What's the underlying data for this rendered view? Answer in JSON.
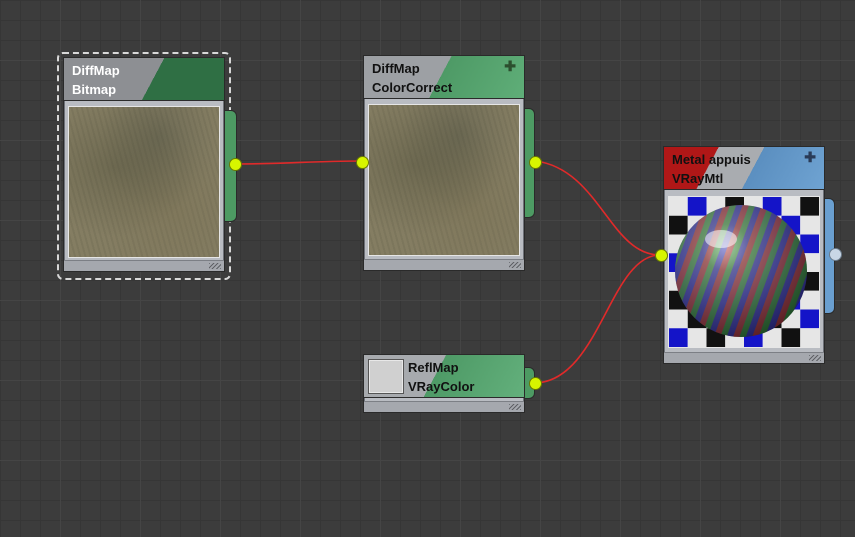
{
  "nodes": {
    "bitmap": {
      "name": "DiffMap",
      "type": "Bitmap"
    },
    "colorcorrect": {
      "name": "DiffMap",
      "type": "ColorCorrect"
    },
    "vraycolor": {
      "name": "ReflMap",
      "type": "VRayColor"
    },
    "material": {
      "name": "Metal appuis",
      "type": "VRayMtl"
    }
  },
  "icons": {
    "expand": "plus-icon"
  },
  "colors": {
    "map_header": "#3f8a55",
    "material_header": "#5b8fc0",
    "material_accent": "#b01717",
    "wire": "#e02a2a",
    "socket_active": "#d7f500"
  }
}
